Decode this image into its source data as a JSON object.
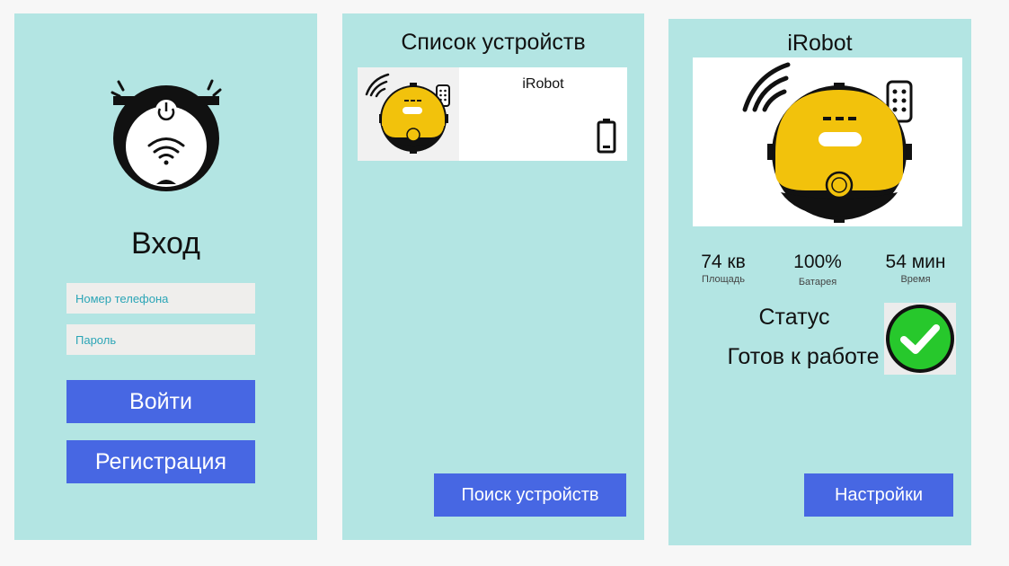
{
  "login_screen": {
    "title": "Вход",
    "phone_placeholder": "Номер телефона",
    "password_placeholder": "Пароль",
    "login_button": "Войти",
    "register_button": "Регистрация",
    "logo_icon": "robot-vacuum-wifi-icon"
  },
  "device_list_screen": {
    "title": "Список устройств",
    "devices": [
      {
        "name": "iRobot",
        "icons": [
          "robot-vacuum-icon",
          "battery-icon"
        ]
      }
    ],
    "search_button": "Поиск устройств"
  },
  "device_screen": {
    "title": "iRobot",
    "stats": [
      {
        "value": "74 кв",
        "label": "Площадь"
      },
      {
        "value": "100%",
        "label": "Батарея"
      },
      {
        "value": "54 мин",
        "label": "Время"
      }
    ],
    "status_title": "Статус",
    "status_text": "Готов к работе",
    "status_icon": "check-circle-icon",
    "settings_button": "Настройки"
  },
  "colors": {
    "panel_bg": "#b3e5e3",
    "button": "#4767e3",
    "input_bg": "#efeeec",
    "placeholder": "#2ba5b6",
    "robot_yellow": "#f2c20c",
    "status_green": "#27c82c"
  }
}
